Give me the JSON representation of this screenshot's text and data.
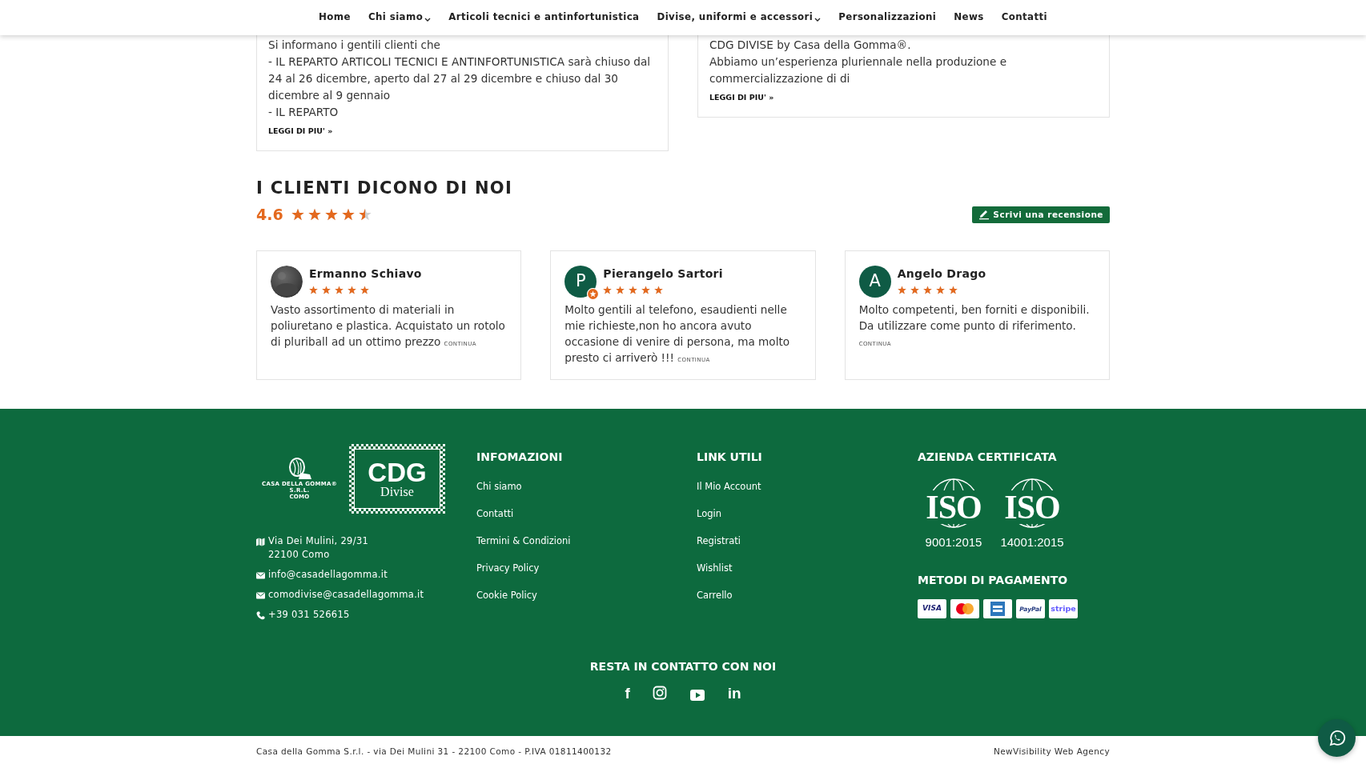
{
  "nav": [
    {
      "label": "Home",
      "dropdown": false
    },
    {
      "label": "Chi siamo",
      "dropdown": true
    },
    {
      "label": "Articoli tecnici e antinfortunistica",
      "dropdown": false
    },
    {
      "label": "Divise, uniformi e accessori",
      "dropdown": true
    },
    {
      "label": "Personalizzazioni",
      "dropdown": false
    },
    {
      "label": "News",
      "dropdown": false
    },
    {
      "label": "Contatti",
      "dropdown": false
    }
  ],
  "news": [
    {
      "paragraphs": [
        "Si informano i gentili clienti che",
        "- IL REPARTO ARTICOLI TECNICI E ANTINFORTUNISTICA sarà chiuso dal 24 al 26 dicembre, aperto dal 27 al 29 dicembre e chiuso dal 30 dicembre al 9 gennaio",
        "- IL REPARTO"
      ],
      "link": "LEGGI DI PIU' »"
    },
    {
      "paragraphs": [
        "CDG DIVISE by Casa della Gomma®.",
        "Abbiamo un’esperienza pluriennale nella produzione e commercializzazione di di"
      ],
      "link": "LEGGI DI PIU' »"
    }
  ],
  "reviews_section": {
    "title": "I CLIENTI DICONO DI NOI",
    "rating": "4.6",
    "stars": 4.5,
    "button": "Scrivi una recensione"
  },
  "reviews": [
    {
      "name": "Ermanno Schiavo",
      "stars": 5,
      "text": "Vasto assortimento di materiali in poliuretano e plastica. Acquistato un rotolo di pluriball ad un ottimo prezzo",
      "more": "CONTINUA"
    },
    {
      "name": "Pierangelo Sartori",
      "avatar": {
        "kind": "letter",
        "letter": "P",
        "badge": true
      },
      "stars": 5,
      "text": "Molto gentili al telefono, esaudienti nelle mie richieste,non ho ancora avuto occasione di venire di persona, ma molto presto ci arriverò !!!",
      "more": "CONTINUA"
    },
    {
      "name": "Angelo Drago",
      "avatar": {
        "kind": "letter",
        "letter": "A",
        "badge": false
      },
      "stars": 5,
      "text": "Molto competenti, ben forniti e disponibili. Da utilizzare come punto di riferimento.",
      "more": "CONTINUA"
    }
  ],
  "footer": {
    "logos": {
      "casa": [
        "CASA DELLA GOMMA®",
        "S.R.L.",
        "COMO"
      ],
      "cdg": [
        "CDG",
        "Divise"
      ]
    },
    "contacts": [
      {
        "kind": "address",
        "lines": [
          "Via Dei Mulini, 29/31",
          "22100 Como"
        ]
      },
      {
        "kind": "email",
        "lines": [
          "info@casadellagomma.it"
        ]
      },
      {
        "kind": "email",
        "lines": [
          "comodivise@casadellagomma.it"
        ]
      },
      {
        "kind": "phone",
        "lines": [
          "+39 031 526615"
        ]
      }
    ],
    "columns": [
      {
        "title": "INFOMAZIONI",
        "links": [
          "Chi siamo",
          "Contatti",
          "Termini & Condizioni",
          "Privacy Policy",
          "Cookie Policy"
        ]
      },
      {
        "title": "LINK UTILI",
        "links": [
          "Il Mio Account",
          "Login",
          "Registrati",
          "Wishlist",
          "Carrello"
        ]
      }
    ],
    "certified": {
      "title": "AZIENDA CERTIFICATA",
      "badges": [
        {
          "mark": "ISO",
          "standard": "9001:2015"
        },
        {
          "mark": "ISO",
          "standard": "14001:2015"
        }
      ]
    },
    "payments": {
      "title": "METODI DI PAGAMENTO",
      "methods": [
        {
          "kind": "visa",
          "label": "VISA"
        },
        {
          "kind": "mastercard"
        },
        {
          "kind": "amex"
        },
        {
          "kind": "paypal",
          "label": "PayPal"
        },
        {
          "kind": "stripe",
          "label": "stripe"
        }
      ]
    },
    "social": {
      "title": "RESTA IN CONTATTO CON NOI",
      "items": [
        {
          "kind": "facebook",
          "glyph": "f"
        },
        {
          "kind": "instagram"
        },
        {
          "kind": "youtube"
        },
        {
          "kind": "linkedin",
          "glyph": "in"
        }
      ]
    }
  },
  "bottom_bar": {
    "left": "Casa della Gomma S.r.l. - via Dei Mulini 31 - 22100 Como - P.IVA 01811400132",
    "right": "NewVisibility Web Agency"
  },
  "chat_button": {
    "kind": "whatsapp"
  }
}
